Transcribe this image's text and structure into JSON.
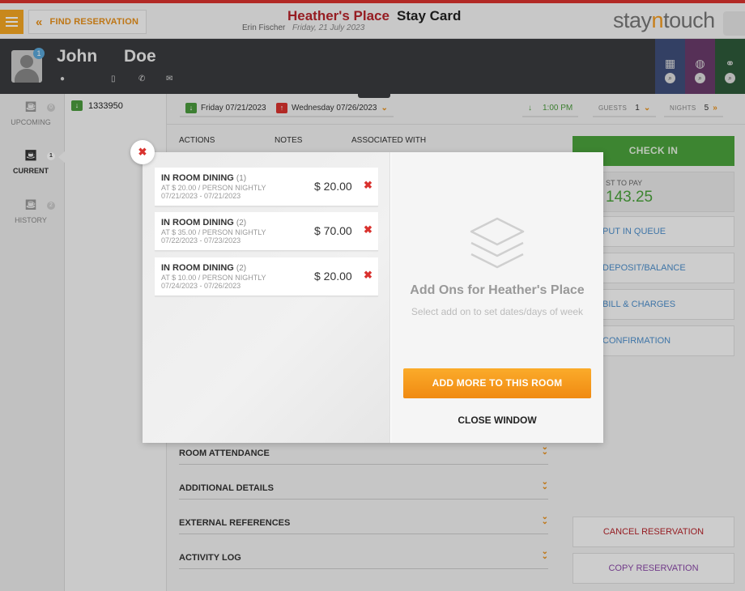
{
  "header": {
    "find_reservation": "FIND RESERVATION",
    "hotel_name": "Heather's Place",
    "title": "Stay Card",
    "user": "Erin Fischer",
    "date": "Friday, 21 July 2023",
    "logo_pre": "stay",
    "logo_accent": "n",
    "logo_post": "touch"
  },
  "guest": {
    "first_name": "John",
    "last_name": "Doe",
    "avatar_badge": "1"
  },
  "left_nav": [
    {
      "label": "UPCOMING",
      "count": "0"
    },
    {
      "label": "CURRENT",
      "count": "1"
    },
    {
      "label": "HISTORY",
      "count": "2"
    }
  ],
  "reservation": {
    "number": "1333950",
    "arrival": "Friday 07/21/2023",
    "departure": "Wednesday 07/26/2023",
    "time": "1:00 PM",
    "guests_label": "GUESTS",
    "guests": "1",
    "nights_label": "NIGHTS",
    "nights": "5"
  },
  "columns": [
    "ACTIONS",
    "NOTES",
    "ASSOCIATED WITH"
  ],
  "sections": [
    "ROOM ATTENDANCE",
    "ADDITIONAL DETAILS",
    "EXTERNAL REFERENCES",
    "ACTIVITY LOG"
  ],
  "sidebar": {
    "check_in": "CHECK IN",
    "cost_label": "ST TO PAY",
    "cost_amount": "143.25",
    "buttons": [
      "PUT IN QUEUE",
      "DEPOSIT/BALANCE",
      "BILL & CHARGES",
      "CONFIRMATION"
    ],
    "cancel": "CANCEL RESERVATION",
    "copy": "COPY RESERVATION"
  },
  "modal": {
    "addons": [
      {
        "name": "IN ROOM DINING",
        "qty": "(1)",
        "rate": "AT $ 20.00 / PERSON NIGHTLY",
        "dates": "07/21/2023 - 07/21/2023",
        "price": "$ 20.00"
      },
      {
        "name": "IN ROOM DINING",
        "qty": "(2)",
        "rate": "AT $ 35.00 / PERSON NIGHTLY",
        "dates": "07/22/2023 - 07/23/2023",
        "price": "$ 70.00"
      },
      {
        "name": "IN ROOM DINING",
        "qty": "(2)",
        "rate": "AT $ 10.00 / PERSON NIGHTLY",
        "dates": "07/24/2023 - 07/26/2023",
        "price": "$ 20.00"
      }
    ],
    "title": "Add Ons for Heather's Place",
    "subtitle": "Select add on to set dates/days of week",
    "add_more": "ADD MORE TO THIS ROOM",
    "close": "CLOSE WINDOW"
  },
  "colors": {
    "brand_red": "#b7242b",
    "accent_orange": "#f39a1e",
    "green": "#4ba33c",
    "link_blue": "#4d8fcc"
  }
}
